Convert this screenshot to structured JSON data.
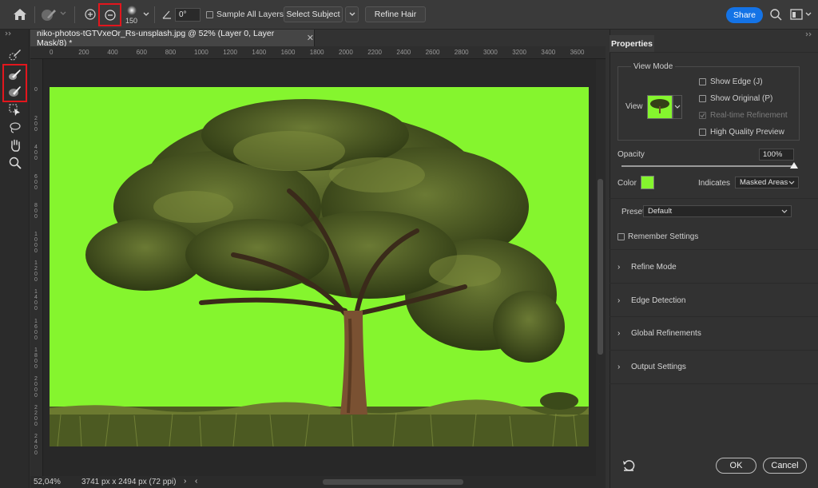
{
  "options_bar": {
    "brush_size": "150",
    "angle_value": "0°",
    "sample_all_layers": "Sample All Layers",
    "select_subject": "Select Subject",
    "refine_hair": "Refine Hair",
    "share": "Share"
  },
  "document": {
    "tab_title": "niko-photos-tGTVxeOr_Rs-unsplash.jpg @ 52% (Layer 0, Layer Mask/8) *",
    "ruler_h": [
      "0",
      "200",
      "400",
      "600",
      "800",
      "1000",
      "1200",
      "1400",
      "1600",
      "1800",
      "2000",
      "2200",
      "2400",
      "2600",
      "2800",
      "3000",
      "3200",
      "3400",
      "3600"
    ],
    "ruler_v": [
      "0",
      "2\n0\n0",
      "4\n0\n0",
      "6\n0\n0",
      "8\n0\n0",
      "1\n0\n0\n0",
      "1\n2\n0\n0",
      "1\n4\n0\n0",
      "1\n6\n0\n0",
      "1\n8\n0\n0",
      "2\n0\n0\n0",
      "2\n2\n0\n0",
      "2\n4\n0\n0"
    ],
    "zoom": "52,04%",
    "doc_info": "3741 px x 2494 px (72 ppi)",
    "overlay_color": "#85f52e"
  },
  "properties": {
    "title": "Properties",
    "view_mode_legend": "View Mode",
    "view_label": "View",
    "show_edge": "Show Edge (J)",
    "show_original": "Show Original (P)",
    "realtime_refinement": "Real-time Refinement",
    "high_quality_preview": "High Quality Preview",
    "opacity_label": "Opacity",
    "opacity_value": "100%",
    "opacity_level": 1.0,
    "color_label": "Color",
    "color_swatch": "#85f52e",
    "indicates_label": "Indicates",
    "indicates_value": "Masked Areas",
    "preset_label": "Preset",
    "preset_value": "Default",
    "remember_settings": "Remember Settings",
    "sections": [
      "Refine Mode",
      "Edge Detection",
      "Global Refinements",
      "Output Settings"
    ],
    "ok": "OK",
    "cancel": "Cancel"
  }
}
